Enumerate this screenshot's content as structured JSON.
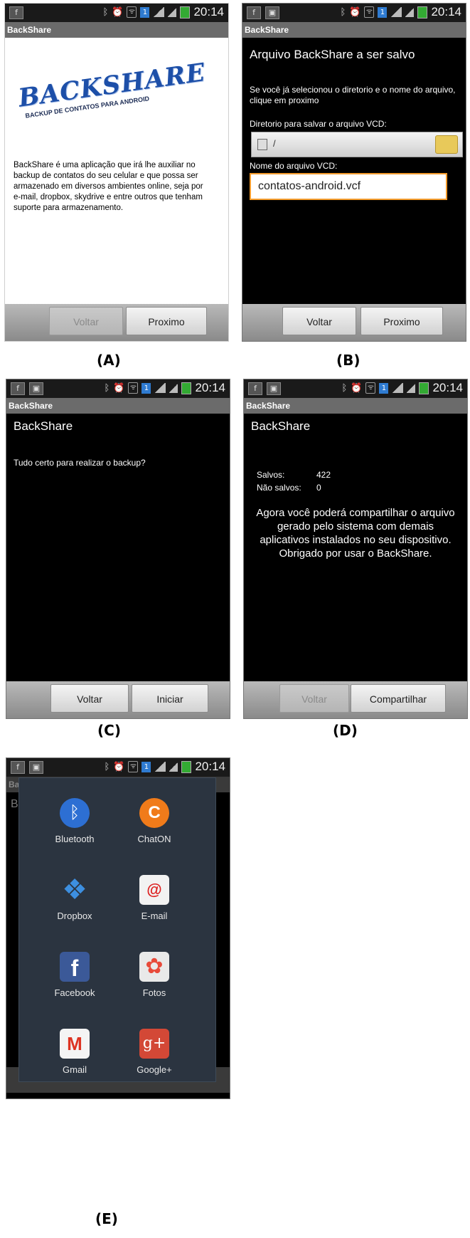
{
  "common": {
    "time": "20:14",
    "app_title": "BackShare",
    "sim_label": "1"
  },
  "screenA": {
    "panel_label": "(A)",
    "logo_title": "BACKSHARE",
    "logo_subtitle": "BACKUP DE CONTATOS PARA ANDROID",
    "description": "BackShare é uma aplicação que irá lhe auxiliar no backup de contatos do seu celular e que possa ser armazenado em diversos ambientes online, seja por e-mail, dropbox, skydrive e entre outros que tenham suporte para armazenamento.",
    "back_label": "Voltar",
    "next_label": "Proximo"
  },
  "screenB": {
    "panel_label": "(B)",
    "heading": "Arquivo BackShare a ser salvo",
    "instruction": "Se você já selecionou o diretorio e o nome do arquivo, clique em proximo",
    "dir_label": "Diretorio para salvar o arquivo VCD:",
    "dir_value": "/",
    "name_label": "Nome do arquivo VCD:",
    "name_value": "contatos-android.vcf",
    "back_label": "Voltar",
    "next_label": "Proximo"
  },
  "screenC": {
    "panel_label": "(C)",
    "heading": "BackShare",
    "question": "Tudo certo para realizar o backup?",
    "back_label": "Voltar",
    "start_label": "Iniciar"
  },
  "screenD": {
    "panel_label": "(D)",
    "heading": "BackShare",
    "saved_label": "Salvos:",
    "saved_value": "422",
    "not_saved_label": "Não salvos:",
    "not_saved_value": "0",
    "message": "Agora você poderá compartilhar o arquivo gerado pelo sistema com demais aplicativos instalados no seu dispositivo. Obrigado por usar o BackShare.",
    "back_label": "Voltar",
    "share_label": "Compartilhar"
  },
  "screenE": {
    "panel_label": "(E)",
    "behind_title": "Ba",
    "behind_heading": "B",
    "items": [
      {
        "label": "Bluetooth",
        "icon": "bluetooth-icon",
        "glyph": "ᛒ"
      },
      {
        "label": "ChatON",
        "icon": "chaton-icon",
        "glyph": "C"
      },
      {
        "label": "Dropbox",
        "icon": "dropbox-icon",
        "glyph": "❖"
      },
      {
        "label": "E-mail",
        "icon": "email-icon",
        "glyph": "@"
      },
      {
        "label": "Facebook",
        "icon": "facebook-icon",
        "glyph": "f"
      },
      {
        "label": "Fotos",
        "icon": "photos-icon",
        "glyph": "✿"
      },
      {
        "label": "Gmail",
        "icon": "gmail-icon",
        "glyph": "M"
      },
      {
        "label": "Google+",
        "icon": "googleplus-icon",
        "glyph": "g+"
      }
    ]
  }
}
